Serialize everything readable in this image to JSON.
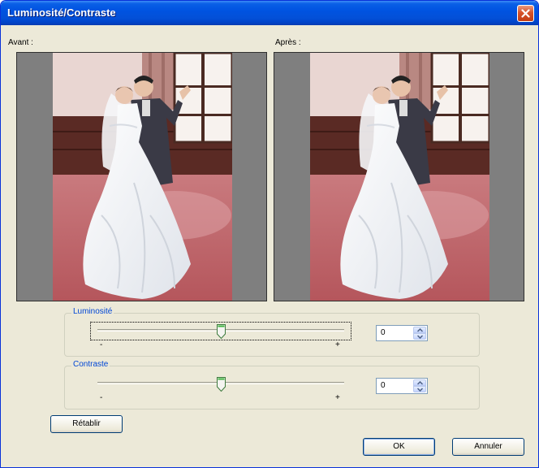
{
  "window": {
    "title": "Luminosité/Contraste"
  },
  "preview": {
    "before_label": "Avant :",
    "after_label": "Après :",
    "image_subject": "wedding-couple-dancing-photo"
  },
  "brightness": {
    "label": "Luminosité",
    "value": "0",
    "min_label": "-",
    "max_label": "+",
    "slider_position": 0.5,
    "focused": true
  },
  "contrast": {
    "label": "Contraste",
    "value": "0",
    "min_label": "-",
    "max_label": "+",
    "slider_position": 0.5
  },
  "buttons": {
    "reset": "Rétablir",
    "ok": "OK",
    "cancel": "Annuler"
  },
  "colors": {
    "titlebar": "#0053e1",
    "dialog_bg": "#ece9d8",
    "group_label": "#0046d5",
    "close_button": "#d6522b"
  },
  "icons": {
    "close": "close-icon",
    "spin_up": "spin-up-icon",
    "spin_down": "spin-down-icon",
    "slider_thumb": "slider-thumb-icon"
  }
}
